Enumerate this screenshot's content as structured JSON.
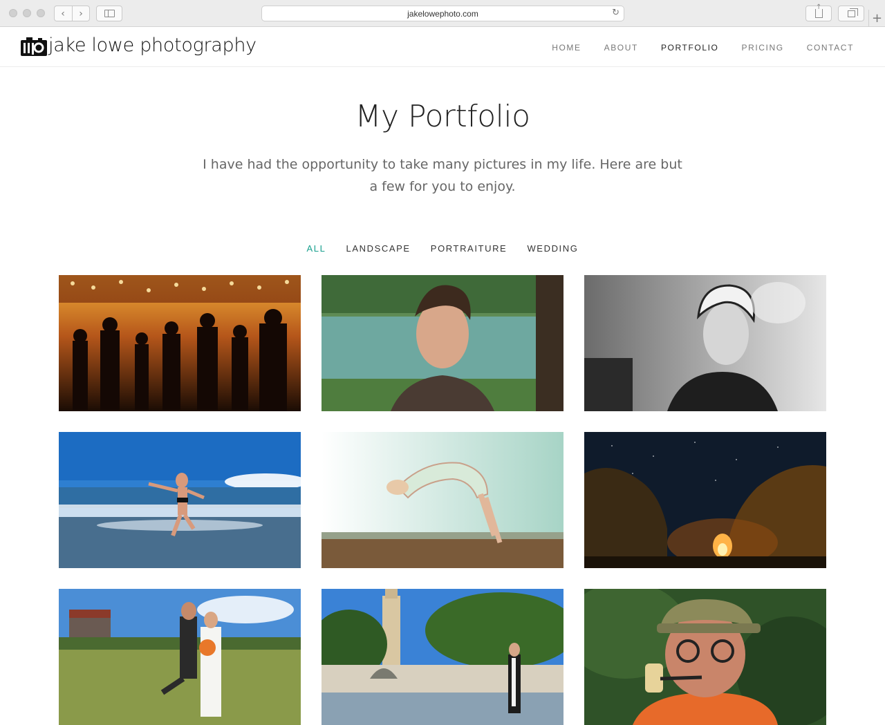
{
  "browser": {
    "url": "jakelowephoto.com"
  },
  "site": {
    "logo_text": "jake lowe photography",
    "logo_mark": "jlp"
  },
  "nav": {
    "items": [
      {
        "label": "HOME",
        "active": false
      },
      {
        "label": "ABOUT",
        "active": false
      },
      {
        "label": "PORTFOLIO",
        "active": true
      },
      {
        "label": "PRICING",
        "active": false
      },
      {
        "label": "CONTACT",
        "active": false
      }
    ]
  },
  "hero": {
    "title": "My Portfolio",
    "subtitle": "I have had the opportunity to take many pictures in my life. Here are but a few for you to enjoy."
  },
  "filters": {
    "items": [
      {
        "label": "ALL",
        "active": true
      },
      {
        "label": "LANDSCAPE",
        "active": false
      },
      {
        "label": "PORTRAITURE",
        "active": false
      },
      {
        "label": "WEDDING",
        "active": false
      }
    ],
    "active_color": "#19a08e"
  },
  "gallery": {
    "photos": [
      {
        "subject": "carousel at night with crowd"
      },
      {
        "subject": "young man portrait by lake"
      },
      {
        "subject": "black and white woman with headscarf"
      },
      {
        "subject": "woman jumping on beach"
      },
      {
        "subject": "dancer levitating backbend"
      },
      {
        "subject": "campfire under starry night"
      },
      {
        "subject": "wedding couple kissing in field"
      },
      {
        "subject": "graduate at university tower fountain"
      },
      {
        "subject": "man with corn cob pipe"
      }
    ]
  }
}
